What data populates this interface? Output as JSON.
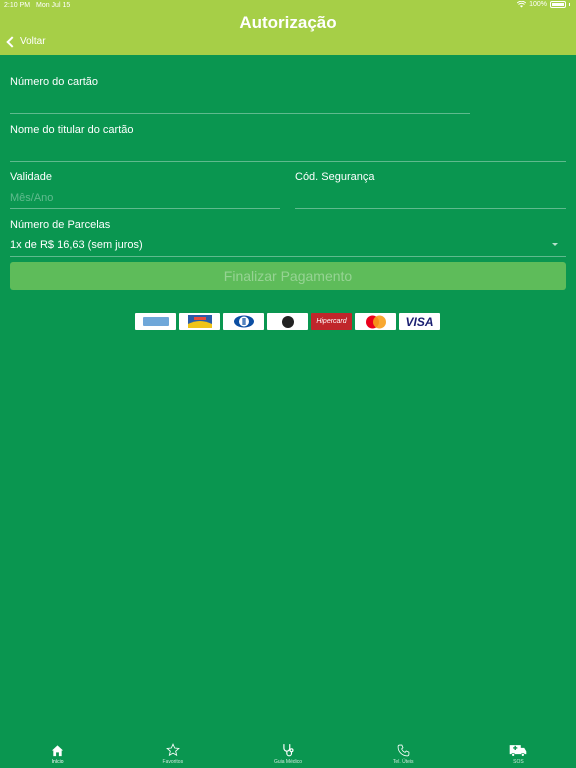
{
  "status_bar": {
    "time": "2:10 PM",
    "date": "Mon Jul 15",
    "battery": "100%"
  },
  "header": {
    "title": "Autorização",
    "back_label": "Voltar"
  },
  "form": {
    "card_number_label": "Número do cartão",
    "card_holder_label": "Nome do titular do cartão",
    "expiry_label": "Validade",
    "expiry_placeholder": "Mês/Ano",
    "security_code_label": "Cód. Segurança",
    "installments_label": "Número de Parcelas",
    "installments_value": "1x de R$ 16,63 (sem juros)",
    "submit_label": "Finalizar Pagamento"
  },
  "cards": {
    "hipercard": "Hipercard",
    "visa": "VISA"
  },
  "tabbar": {
    "tabs": [
      {
        "label": "Início",
        "icon": "home-icon"
      },
      {
        "label": "Favoritos",
        "icon": "star-icon"
      },
      {
        "label": "Guia Médico",
        "icon": "stethoscope-icon"
      },
      {
        "label": "Tel. Úteis",
        "icon": "phone-icon"
      },
      {
        "label": "SOS",
        "icon": "ambulance-icon"
      }
    ]
  },
  "colors": {
    "header": "#a6cf47",
    "background": "#0a9650",
    "button": "#5ebc5a"
  }
}
